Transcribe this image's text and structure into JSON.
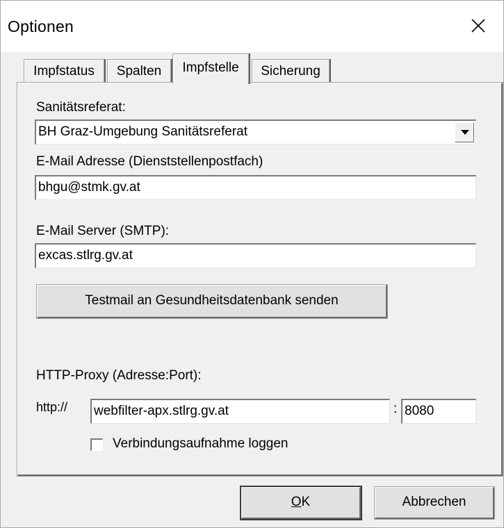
{
  "window": {
    "title": "Optionen",
    "close_icon": "close-icon"
  },
  "tabs": [
    {
      "label": "Impfstatus",
      "active": false
    },
    {
      "label": "Spalten",
      "active": false
    },
    {
      "label": "Impfstelle",
      "active": true
    },
    {
      "label": "Sicherung",
      "active": false
    }
  ],
  "form": {
    "sanitaetsreferat_label": "Sanitätsreferat:",
    "sanitaetsreferat_value": "BH Graz-Umgebung Sanitätsreferat",
    "email_label": "E-Mail Adresse (Dienststellenpostfach)",
    "email_value": "bhgu@stmk.gv.at",
    "smtp_label": "E-Mail Server (SMTP):",
    "smtp_value": "excas.stlrg.gv.at",
    "testmail_button": "Testmail an Gesundheitsdatenbank senden",
    "proxy_label": "HTTP-Proxy (Adresse:Port):",
    "proxy_prefix": "http://",
    "proxy_address": "webfilter-apx.stlrg.gv.at",
    "proxy_separator": ":",
    "proxy_port": "8080",
    "log_checkbox_label": "Verbindungsaufnahme loggen",
    "log_checkbox_checked": false
  },
  "buttons": {
    "ok_mnemonic": "O",
    "ok_rest": "K",
    "cancel": "Abbrechen"
  }
}
